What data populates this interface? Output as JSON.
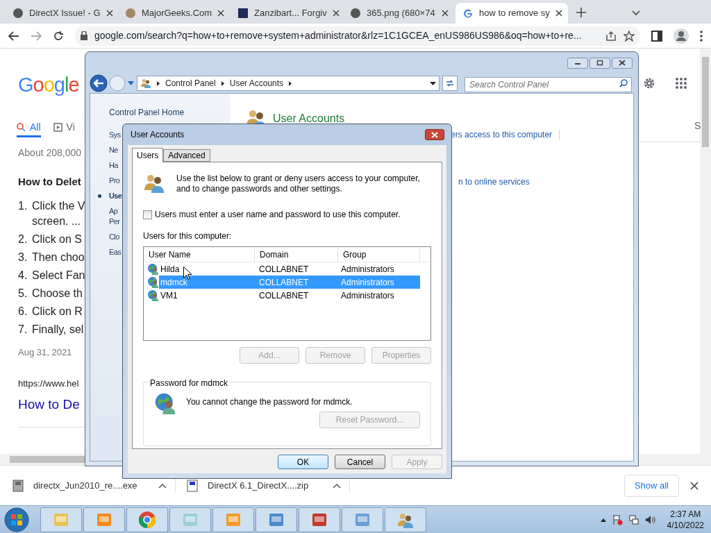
{
  "browser": {
    "tabs": [
      {
        "title": "DirectX Issue! - G",
        "selected": false
      },
      {
        "title": "MajorGeeks.Com",
        "selected": false
      },
      {
        "title": "Zanzibart... Forgiv",
        "selected": false
      },
      {
        "title": "365.png (680×74",
        "selected": false
      },
      {
        "title": "how to remove sy",
        "selected": true
      }
    ],
    "address": "google.com/search?q=how+to+remove+system+administrator&rlz=1C1GCEA_enUS986US986&oq=how+to+re...",
    "page": {
      "logo": "Google",
      "search_tabs": [
        {
          "label": "All",
          "selected": true
        },
        {
          "label": "Vi",
          "selected": false
        }
      ],
      "results_count": "About 208,000",
      "heading": "How to Delet",
      "steps": [
        {
          "number": "1.",
          "lines": [
            "Click the V",
            "screen. ..."
          ]
        },
        {
          "number": "2.",
          "lines": [
            "Click on S"
          ]
        },
        {
          "number": "3.",
          "lines": [
            "Then choo"
          ]
        },
        {
          "number": "4.",
          "lines": [
            "Select Fan"
          ]
        },
        {
          "number": "5.",
          "lines": [
            "Choose th"
          ]
        },
        {
          "number": "6.",
          "lines": [
            "Click on R"
          ]
        },
        {
          "number": "7.",
          "lines": [
            "Finally, sel"
          ]
        }
      ],
      "date": "Aug 31, 2021",
      "url": "https://www.hel",
      "link_title": "How to De",
      "side_letter": "S"
    },
    "downloads": [
      {
        "name": "directx_Jun2010_re....exe"
      },
      {
        "name": "DirectX 6.1_DirectX....zip"
      }
    ],
    "show_all": "Show all"
  },
  "control_panel": {
    "breadcrumb": [
      "Control Panel",
      "User Accounts"
    ],
    "search_placeholder": "Search Control Panel",
    "sidebar": [
      {
        "lines": [
          "Control Panel Home"
        ],
        "selected": false
      },
      {
        "lines": [
          "Sys"
        ],
        "selected": false
      },
      {
        "lines": [
          "Ne"
        ],
        "selected": false
      },
      {
        "lines": [
          "Ha"
        ],
        "selected": false
      },
      {
        "lines": [
          "Pro"
        ],
        "selected": false
      },
      {
        "lines": [
          "Use"
        ],
        "selected": true
      },
      {
        "lines": [
          "Ap",
          "Per"
        ],
        "selected": false
      },
      {
        "lines": [
          "Clo"
        ],
        "selected": false
      },
      {
        "lines": [
          "Eas"
        ],
        "selected": false
      }
    ],
    "heading": "User Accounts",
    "links": [
      "ers access to this computer",
      "n to online services"
    ]
  },
  "dialog": {
    "title": "User Accounts",
    "tabs": [
      {
        "label": "Users",
        "selected": true
      },
      {
        "label": "Advanced",
        "selected": false
      }
    ],
    "intro": "Use the list below to grant or deny users access to your computer, and to change passwords and other settings.",
    "checkbox": {
      "label": "Users must enter a user name and password to use this computer.",
      "checked": false
    },
    "users_label": "Users for this computer:",
    "columns": [
      "User Name",
      "Domain",
      "Group"
    ],
    "rows": [
      {
        "cells": [
          "Hilda",
          "COLLABNET",
          "Administrators"
        ],
        "selected": false
      },
      {
        "cells": [
          "mdmck",
          "COLLABNET",
          "Administrators"
        ],
        "selected": true
      },
      {
        "cells": [
          "VM1",
          "COLLABNET",
          "Administrators"
        ],
        "selected": false
      }
    ],
    "list_buttons": [
      {
        "label": "Add...",
        "disabled": true
      },
      {
        "label": "Remove",
        "disabled": true
      },
      {
        "label": "Properties",
        "disabled": true
      }
    ],
    "password_group": {
      "title": "Password for mdmck",
      "message": "You cannot change the password for mdmck.",
      "button": {
        "label": "Reset Password...",
        "disabled": true
      }
    },
    "footer_buttons": [
      {
        "label": "OK",
        "disabled": false
      },
      {
        "label": "Cancel",
        "disabled": false
      },
      {
        "label": "Apply",
        "disabled": true
      }
    ]
  },
  "taskbar": {
    "time": "2:37 AM",
    "date": "4/10/2022"
  }
}
